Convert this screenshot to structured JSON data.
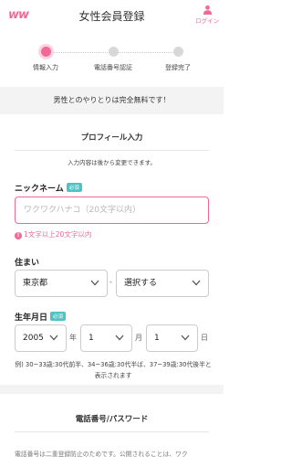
{
  "header": {
    "logo": "ww",
    "title": "女性会員登録",
    "login_label": "ログイン"
  },
  "stepper": {
    "steps": [
      {
        "label": "情報入力",
        "active": true
      },
      {
        "label": "電話番号認証",
        "active": false
      },
      {
        "label": "登録完了",
        "active": false
      }
    ]
  },
  "banner": {
    "text": "男性とのやりとりは完全無料です！"
  },
  "profile": {
    "title": "プロフィール入力",
    "note": "入力内容は後から変更できます。",
    "nickname": {
      "label": "ニックネーム",
      "badge": "必須",
      "placeholder": "ワクワクハナコ（20文字以内）",
      "value": "",
      "error": "1文字以上20文字以内"
    },
    "residence": {
      "label": "住まい",
      "prefecture": "東京都",
      "separator": "-",
      "city": "選択する"
    },
    "birthdate": {
      "label": "生年月日",
      "badge": "必須",
      "year": "2005",
      "year_unit": "年",
      "month": "1",
      "month_unit": "月",
      "day": "1",
      "day_unit": "日",
      "example": "例) 30~33歳:30代前半、34~36歳:30代半ば、37~39歳:30代後半と表示されます"
    }
  },
  "phone_section": {
    "title": "電話番号/パスワード",
    "cut_text": "電話番号は二重登録防止のためです。公開されることは、ワク"
  },
  "colors": {
    "accent": "#f06a95",
    "badge": "#4cc4c4",
    "banner_bg": "#f3f3f3"
  }
}
